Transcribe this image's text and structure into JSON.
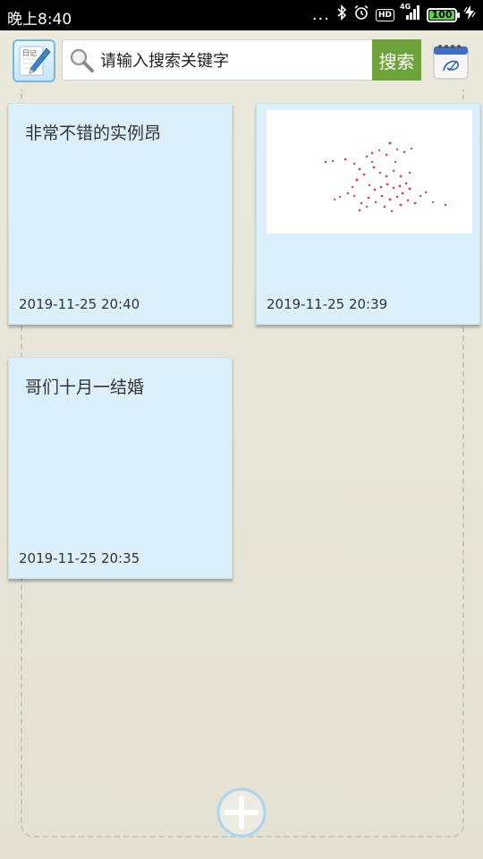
{
  "status_bar": {
    "time": "晚上8:40",
    "dots": "...",
    "hd": "HD",
    "network": "4G",
    "battery": "100"
  },
  "search": {
    "placeholder": "请输入搜索关键字",
    "button_label": "搜索"
  },
  "app_icon_label": "日记",
  "notes": [
    {
      "title": "非常不错的实例昂",
      "time": "2019-11-25 20:40",
      "has_image": false
    },
    {
      "title": "",
      "time": "2019-11-25 20:39",
      "has_image": true
    },
    {
      "title": "哥们十月一结婚",
      "time": "2019-11-25 20:35",
      "has_image": false
    }
  ],
  "colors": {
    "accent_green": "#6ea23b",
    "note_bg": "#dcf0fb",
    "icon_blue": "#78b7dc"
  }
}
